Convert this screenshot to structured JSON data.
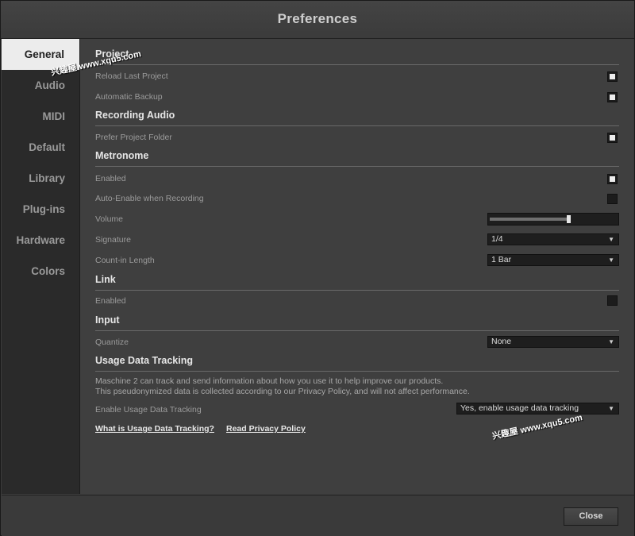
{
  "window": {
    "title": "Preferences"
  },
  "sidebar": {
    "items": [
      {
        "label": "General",
        "active": true
      },
      {
        "label": "Audio"
      },
      {
        "label": "MIDI"
      },
      {
        "label": "Default"
      },
      {
        "label": "Library"
      },
      {
        "label": "Plug-ins"
      },
      {
        "label": "Hardware"
      },
      {
        "label": "Colors"
      }
    ]
  },
  "sections": {
    "project": {
      "header": "Project",
      "reload_last_project": {
        "label": "Reload Last Project",
        "checked": true
      },
      "automatic_backup": {
        "label": "Automatic Backup",
        "checked": true
      }
    },
    "recording_audio": {
      "header": "Recording Audio",
      "prefer_project_folder": {
        "label": "Prefer Project Folder",
        "checked": true
      }
    },
    "metronome": {
      "header": "Metronome",
      "enabled": {
        "label": "Enabled",
        "checked": true
      },
      "auto_enable": {
        "label": "Auto-Enable when Recording",
        "checked": false
      },
      "volume": {
        "label": "Volume",
        "level": 0.6
      },
      "signature": {
        "label": "Signature",
        "value": "1/4"
      },
      "count_in": {
        "label": "Count-in Length",
        "value": "1 Bar"
      }
    },
    "link": {
      "header": "Link",
      "enabled": {
        "label": "Enabled",
        "checked": false
      }
    },
    "input": {
      "header": "Input",
      "quantize": {
        "label": "Quantize",
        "value": "None"
      }
    },
    "usage": {
      "header": "Usage Data Tracking",
      "desc_line1": "Maschine 2 can track and send information about how you use it to help improve our products.",
      "desc_line2": "This pseudonymized data is collected according to our Privacy Policy, and will not affect performance.",
      "enable": {
        "label": "Enable Usage Data Tracking",
        "value": "Yes, enable usage data tracking"
      },
      "link_what": "What is Usage Data Tracking?",
      "link_privacy": "Read Privacy Policy"
    }
  },
  "footer": {
    "close_label": "Close"
  },
  "watermarks": {
    "top": "兴趣屋 www.xqu5.com",
    "bottom": "兴趣屋 www.xqu5.com"
  },
  "colors": {
    "background": "#3f3f3f",
    "sidebar": "#2a2a2a",
    "active_tab": "#ececec"
  }
}
